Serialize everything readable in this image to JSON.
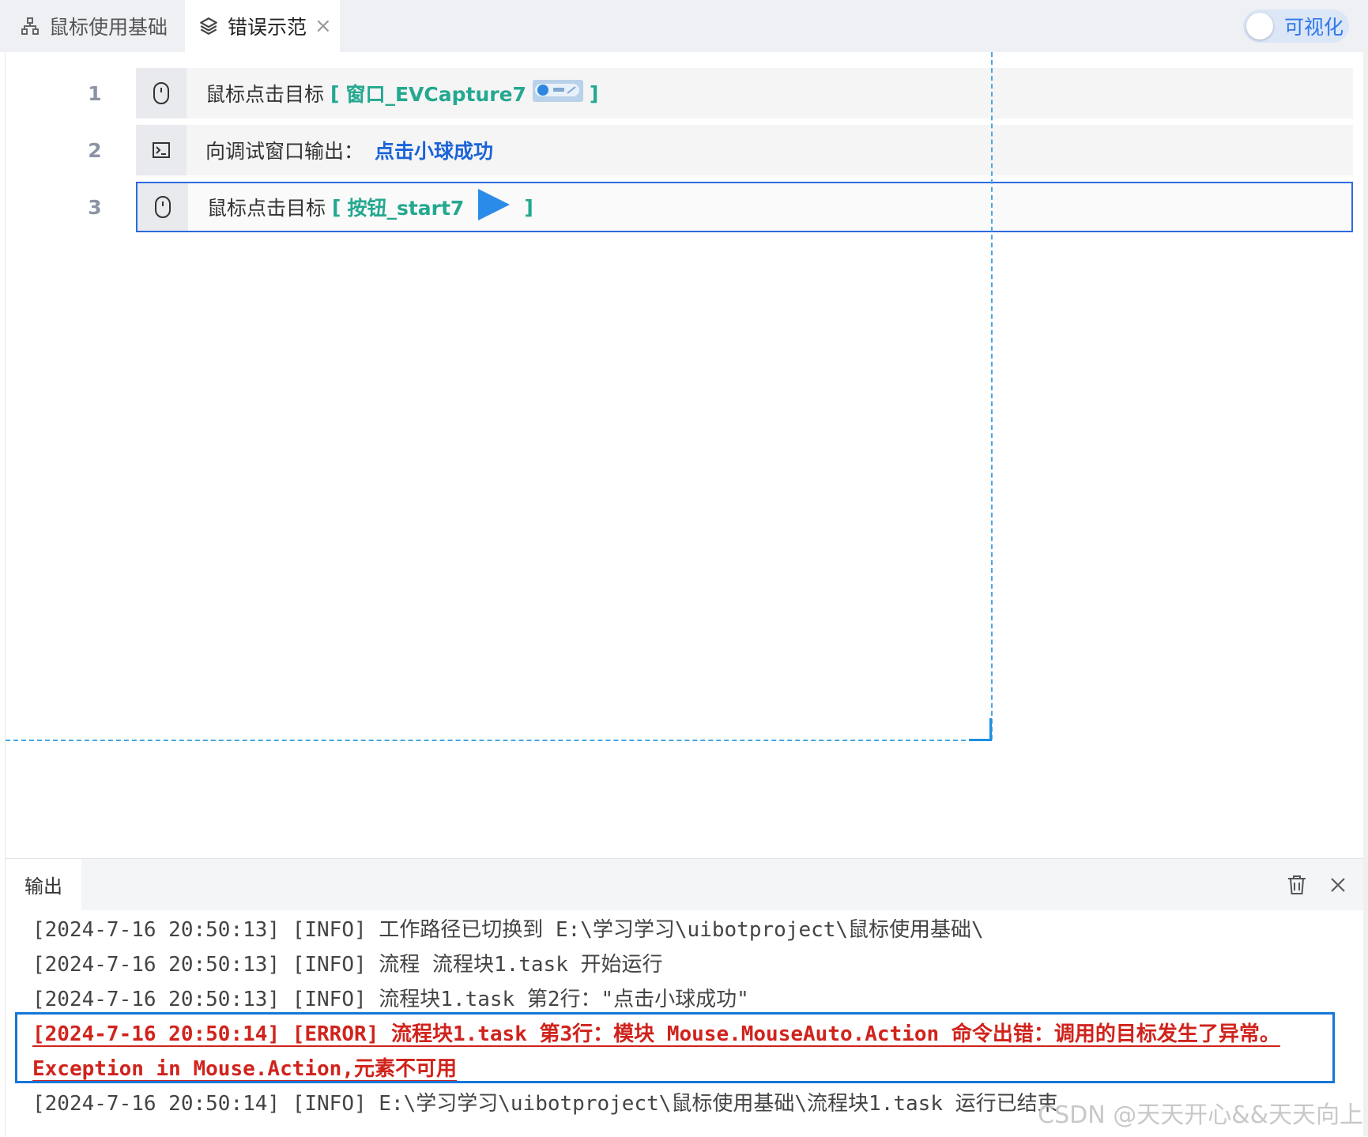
{
  "tabs": [
    {
      "label": "鼠标使用基础",
      "icon": "flowchart-icon"
    },
    {
      "label": "错误示范",
      "icon": "layers-icon",
      "close": "×"
    }
  ],
  "toggle": {
    "label": "可视化",
    "state": "off"
  },
  "editor": {
    "lines": [
      {
        "no": "1",
        "icon": "mouse-icon",
        "text": "鼠标点击目标",
        "open": "[",
        "target": "窗口_EVCapture7",
        "close": "]"
      },
      {
        "no": "2",
        "icon": "terminal-icon",
        "text": "向调试窗口输出：",
        "value": "点击小球成功"
      },
      {
        "no": "3",
        "icon": "mouse-icon",
        "text": "鼠标点击目标",
        "open": "[",
        "target": "按钮_start7",
        "close": "]"
      }
    ]
  },
  "output": {
    "tab_label": "输出",
    "lines": [
      "[2024-7-16 20:50:13] [INFO] 工作路径已切换到 E:\\学习学习\\uibotproject\\鼠标使用基础\\",
      "[2024-7-16 20:50:13] [INFO] 流程 流程块1.task 开始运行",
      "[2024-7-16 20:50:13] [INFO] 流程块1.task 第2行：\"点击小球成功\"",
      "[2024-7-16 20:50:14] [ERROR] 流程块1.task 第3行：模块 Mouse.MouseAuto.Action 命令出错：调用的目标发生了异常。",
      "Exception in Mouse.Action,元素不可用",
      "[2024-7-16 20:50:14] [INFO] E:\\学习学习\\uibotproject\\鼠标使用基础\\流程块1.task 运行已结束"
    ]
  },
  "watermark": "CSDN @天天开心&&天天向上",
  "colors": {
    "accent": "#2d6ae0",
    "teal": "#25a890",
    "error": "#d0231c",
    "guide": "#4aa6e6"
  }
}
